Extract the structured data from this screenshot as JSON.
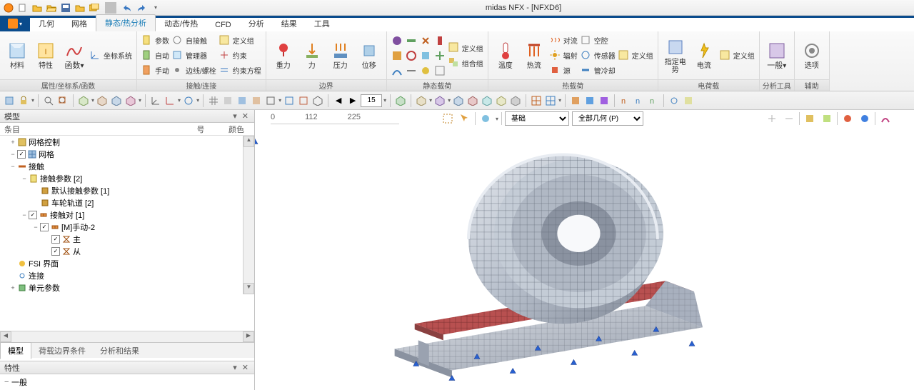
{
  "window": {
    "title": "midas NFX - [NFXD6]"
  },
  "ribbon": {
    "tabs": [
      "几何",
      "网格",
      "静态/热分析",
      "动态/传热",
      "CFD",
      "分析",
      "结果",
      "工具"
    ],
    "active": 2,
    "groups": {
      "attr": {
        "label": "属性/坐标系/函数",
        "material": "材料",
        "property": "特性",
        "function": "函数",
        "coord": "坐标系统",
        "param": "参数",
        "auto": "自动",
        "manual": "手动",
        "autoContact": "自接触",
        "manager": "管理器",
        "edgeBolt": "边线/螺栓"
      },
      "contact": {
        "label": "接触/连接",
        "defineSet": "定义组",
        "constraint": "约束",
        "eqConstraint": "约束方程"
      },
      "boundary": {
        "label": "边界",
        "gravity": "重力",
        "force": "力",
        "pressure": "压力",
        "disp": "位移"
      },
      "staticLoad": {
        "label": "静态载荷",
        "defineSet": "定义组",
        "combineSet": "组合组"
      },
      "thermalLoad": {
        "label": "热载荷",
        "temp": "温度",
        "heatflow": "热流",
        "convection": "对流",
        "radiation": "辐射",
        "cavity": "空腔",
        "sensor": "传感器",
        "source": "源",
        "pipeCool": "管冷却",
        "defineSet": "定义组"
      },
      "elecLoad": {
        "label": "电荷载",
        "potential": "指定电势",
        "current": "电流",
        "defineSet": "定义组"
      },
      "analysisTool": {
        "label": "分析工具",
        "general": "一般"
      },
      "aux": {
        "label": "辅助",
        "options": "选项"
      }
    }
  },
  "toolbar_input": "15",
  "leftPane": {
    "model": "模型",
    "cols": {
      "item": "条目",
      "num": "号",
      "color": "颜色"
    },
    "tree": [
      {
        "exp": "+",
        "pad": 12,
        "ico": "mesh-ctrl",
        "lbl": "网格控制"
      },
      {
        "exp": "−",
        "pad": 12,
        "chk": true,
        "ico": "mesh",
        "lbl": "网格"
      },
      {
        "exp": "−",
        "pad": 12,
        "ico": "contact",
        "lbl": "接触"
      },
      {
        "exp": "−",
        "pad": 28,
        "ico": "param",
        "lbl": "接触参数 [2]"
      },
      {
        "exp": "",
        "pad": 44,
        "ico": "leaf",
        "lbl": "默认接触参数 [1]"
      },
      {
        "exp": "",
        "pad": 44,
        "ico": "leaf",
        "lbl": "车轮轨道 [2]"
      },
      {
        "exp": "−",
        "pad": 28,
        "chk": true,
        "ico": "pair",
        "lbl": "接触对 [1]"
      },
      {
        "exp": "−",
        "pad": 44,
        "chk": true,
        "ico": "pair",
        "lbl": "[M]手动-2"
      },
      {
        "exp": "",
        "pad": 60,
        "chk": true,
        "ico": "hourglass",
        "lbl": "主"
      },
      {
        "exp": "",
        "pad": 60,
        "chk": true,
        "ico": "hourglass",
        "lbl": "从"
      },
      {
        "exp": "",
        "pad": 12,
        "ico": "fsi",
        "lbl": "FSI 界面"
      },
      {
        "exp": "",
        "pad": 12,
        "ico": "link",
        "lbl": "连接"
      },
      {
        "exp": "+",
        "pad": 12,
        "ico": "elem",
        "lbl": "单元参数"
      }
    ],
    "bottomTabs": [
      "模型",
      "荷载边界条件",
      "分析和结果"
    ],
    "propTitle": "特性",
    "propRow": "一般"
  },
  "viewport": {
    "ruler": [
      "0",
      "112",
      "225"
    ],
    "base": "基础",
    "allGeom": "全部几何 (P)"
  }
}
